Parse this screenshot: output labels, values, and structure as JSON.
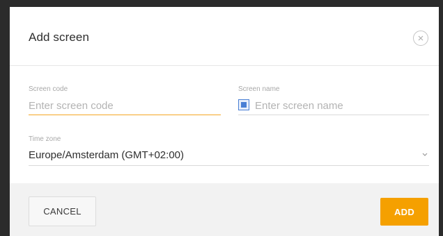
{
  "dialog": {
    "title": "Add screen",
    "close_icon": "close-icon"
  },
  "form": {
    "screen_code": {
      "label": "Screen code",
      "placeholder": "Enter screen code",
      "value": ""
    },
    "screen_name": {
      "label": "Screen name",
      "placeholder": "Enter screen name",
      "value": "",
      "icon": "checkbox-icon"
    },
    "time_zone": {
      "label": "Time zone",
      "selected": "Europe/Amsterdam (GMT+02:00)",
      "icon": "chevron-down-icon"
    }
  },
  "footer": {
    "cancel_label": "CANCEL",
    "add_label": "ADD"
  },
  "colors": {
    "accent": "#f5a000",
    "focus_underline": "#f5a623",
    "checkbox": "#4a7fd4",
    "footer_bg": "#f2f2f2"
  }
}
